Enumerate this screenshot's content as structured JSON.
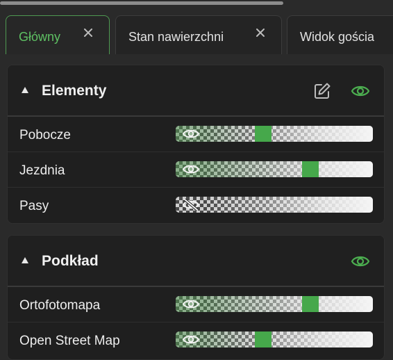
{
  "tabs": [
    {
      "label": "Główny",
      "active": true,
      "closable": true
    },
    {
      "label": "Stan nawierzchni",
      "active": false,
      "closable": true
    },
    {
      "label": "Widok gościa",
      "active": false,
      "closable": false
    }
  ],
  "colors": {
    "accent": "#4caf50",
    "background": "#2a2a2a",
    "panel": "#1f1f1f"
  },
  "panels": [
    {
      "title": "Elementy",
      "icons": [
        "edit-icon",
        "eye-icon"
      ],
      "layers": [
        {
          "label": "Pobocze",
          "visible": true,
          "opacity": 0.44
        },
        {
          "label": "Jezdnia",
          "visible": true,
          "opacity": 0.7
        },
        {
          "label": "Pasy",
          "visible": false,
          "opacity": 0.0
        }
      ]
    },
    {
      "title": "Podkład",
      "icons": [
        "eye-icon"
      ],
      "layers": [
        {
          "label": "Ortofotomapa",
          "visible": true,
          "opacity": 0.7
        },
        {
          "label": "Open Street Map",
          "visible": true,
          "opacity": 0.44
        }
      ]
    }
  ]
}
